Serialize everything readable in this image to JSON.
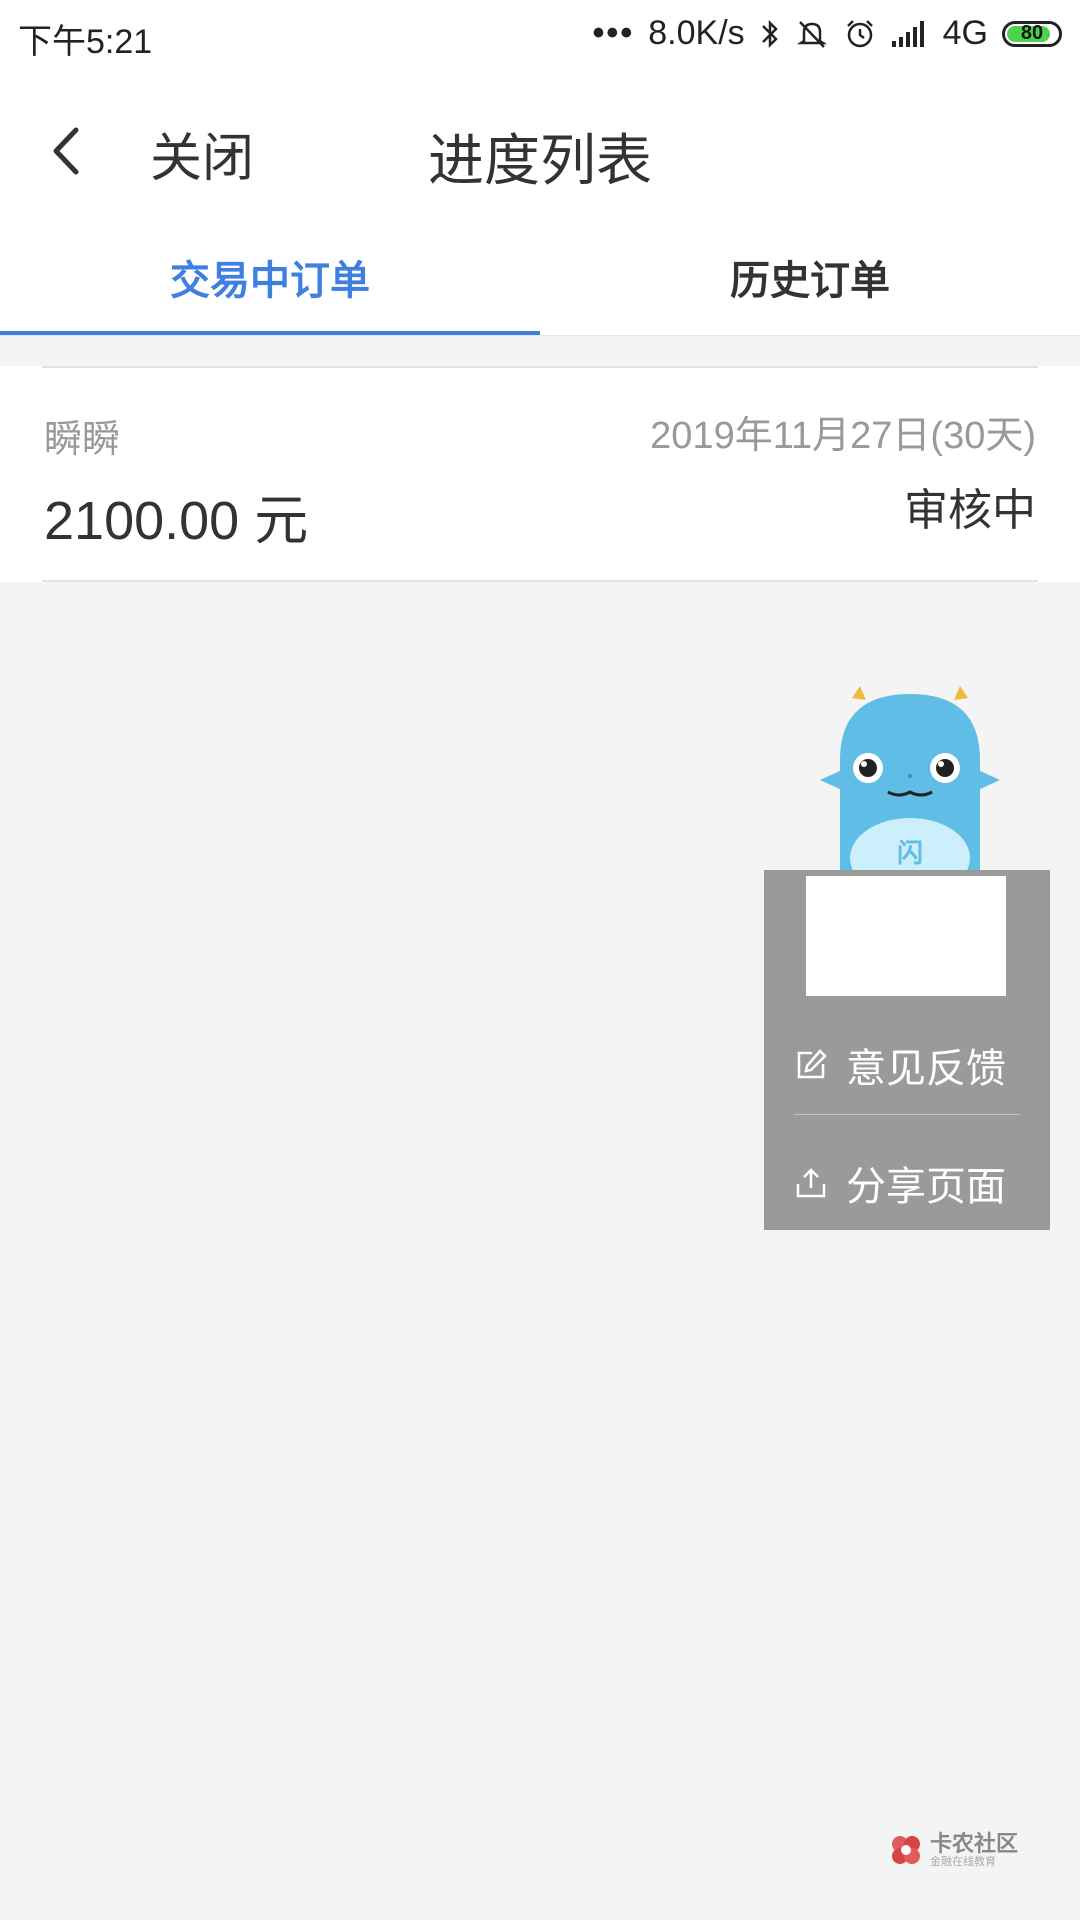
{
  "status_bar": {
    "time": "下午5:21",
    "dots": "•••",
    "speed": "8.0K/s",
    "network": "4G",
    "battery": "80",
    "battery_color": "#4bd44b"
  },
  "header": {
    "close_label": "关闭",
    "title": "进度列表"
  },
  "tabs": [
    {
      "label": "交易中订单",
      "active": true
    },
    {
      "label": "历史订单",
      "active": false
    }
  ],
  "accent_color": "#3e7fe0",
  "order": {
    "name": "瞬瞬",
    "date": "2019年11月27日(30天)",
    "amount": "2100.00 元",
    "status": "审核中"
  },
  "float_menu": {
    "feedback_label": "意见反馈",
    "share_label": "分享页面",
    "mascot_badge": "闪"
  },
  "watermark": {
    "main": "卡农社区",
    "sub": "金融在线教育"
  }
}
